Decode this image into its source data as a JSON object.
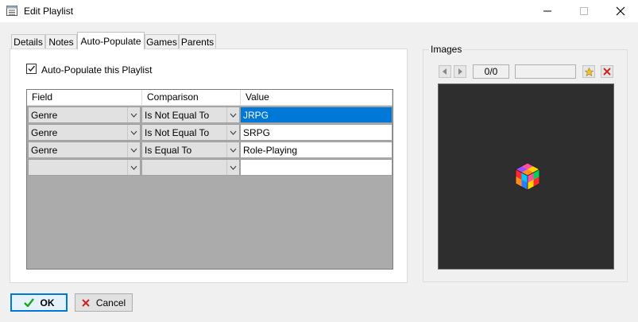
{
  "window": {
    "title": "Edit Playlist"
  },
  "tabs": [
    {
      "label": "Details"
    },
    {
      "label": "Notes"
    },
    {
      "label": "Auto-Populate"
    },
    {
      "label": "Games"
    },
    {
      "label": "Parents"
    }
  ],
  "active_tab": "Auto-Populate",
  "auto_populate": {
    "checkbox_label": "Auto-Populate this Playlist",
    "checked": true
  },
  "grid": {
    "headers": [
      "Field",
      "Comparison",
      "Value"
    ],
    "rows": [
      {
        "field": "Genre",
        "comparison": "Is Not Equal To",
        "value": "JRPG"
      },
      {
        "field": "Genre",
        "comparison": "Is Not Equal To",
        "value": "SRPG"
      },
      {
        "field": "Genre",
        "comparison": "Is Equal To",
        "value": "Role-Playing"
      },
      {
        "field": "",
        "comparison": "",
        "value": ""
      }
    ],
    "selected_row": 0
  },
  "images": {
    "label": "Images",
    "counter": "0/0",
    "name_value": ""
  },
  "buttons": {
    "ok": "OK",
    "cancel": "Cancel"
  },
  "colors": {
    "accent": "#0078d7",
    "preview_bg": "#2e2e2e",
    "grid_bg": "#ababab"
  }
}
